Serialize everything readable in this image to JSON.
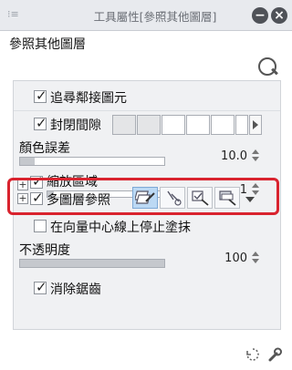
{
  "title_bar": {
    "title": "工具屬性[參照其他圖層]"
  },
  "subtool": {
    "name": "參照其他圖層"
  },
  "properties": {
    "follow_adjacent": {
      "label": "追尋鄰接圖元",
      "checked": true
    },
    "close_gap": {
      "label": "封閉間隙",
      "checked": true
    },
    "color_margin": {
      "label": "顏色誤差",
      "value": "10.0",
      "level_percent": 10
    },
    "scale_area": {
      "label": "縮放區域",
      "value": "1",
      "checked": true,
      "level_percent": 5
    },
    "multi_layer_ref": {
      "label": "多圖層參照",
      "checked": true
    },
    "stop_at_vector_center": {
      "label": "在向量中心線上停止塗抹",
      "checked": false
    },
    "opacity": {
      "label": "不透明度",
      "value": "100",
      "level_percent": 100
    },
    "antialias": {
      "label": "消除鋸齒",
      "checked": true
    }
  },
  "icons": {
    "window_grip": "grip-icon",
    "collapse": "minimize-icon",
    "close": "close-icon",
    "subtool_search": "magnifier-icon",
    "footer_reset": "reset-icon",
    "footer_settings": "wrench-icon"
  },
  "colors": {
    "highlight": "#d9232e",
    "active_icon_bg": "#bcd9f4",
    "panel_bg": "#f0f1f3"
  }
}
